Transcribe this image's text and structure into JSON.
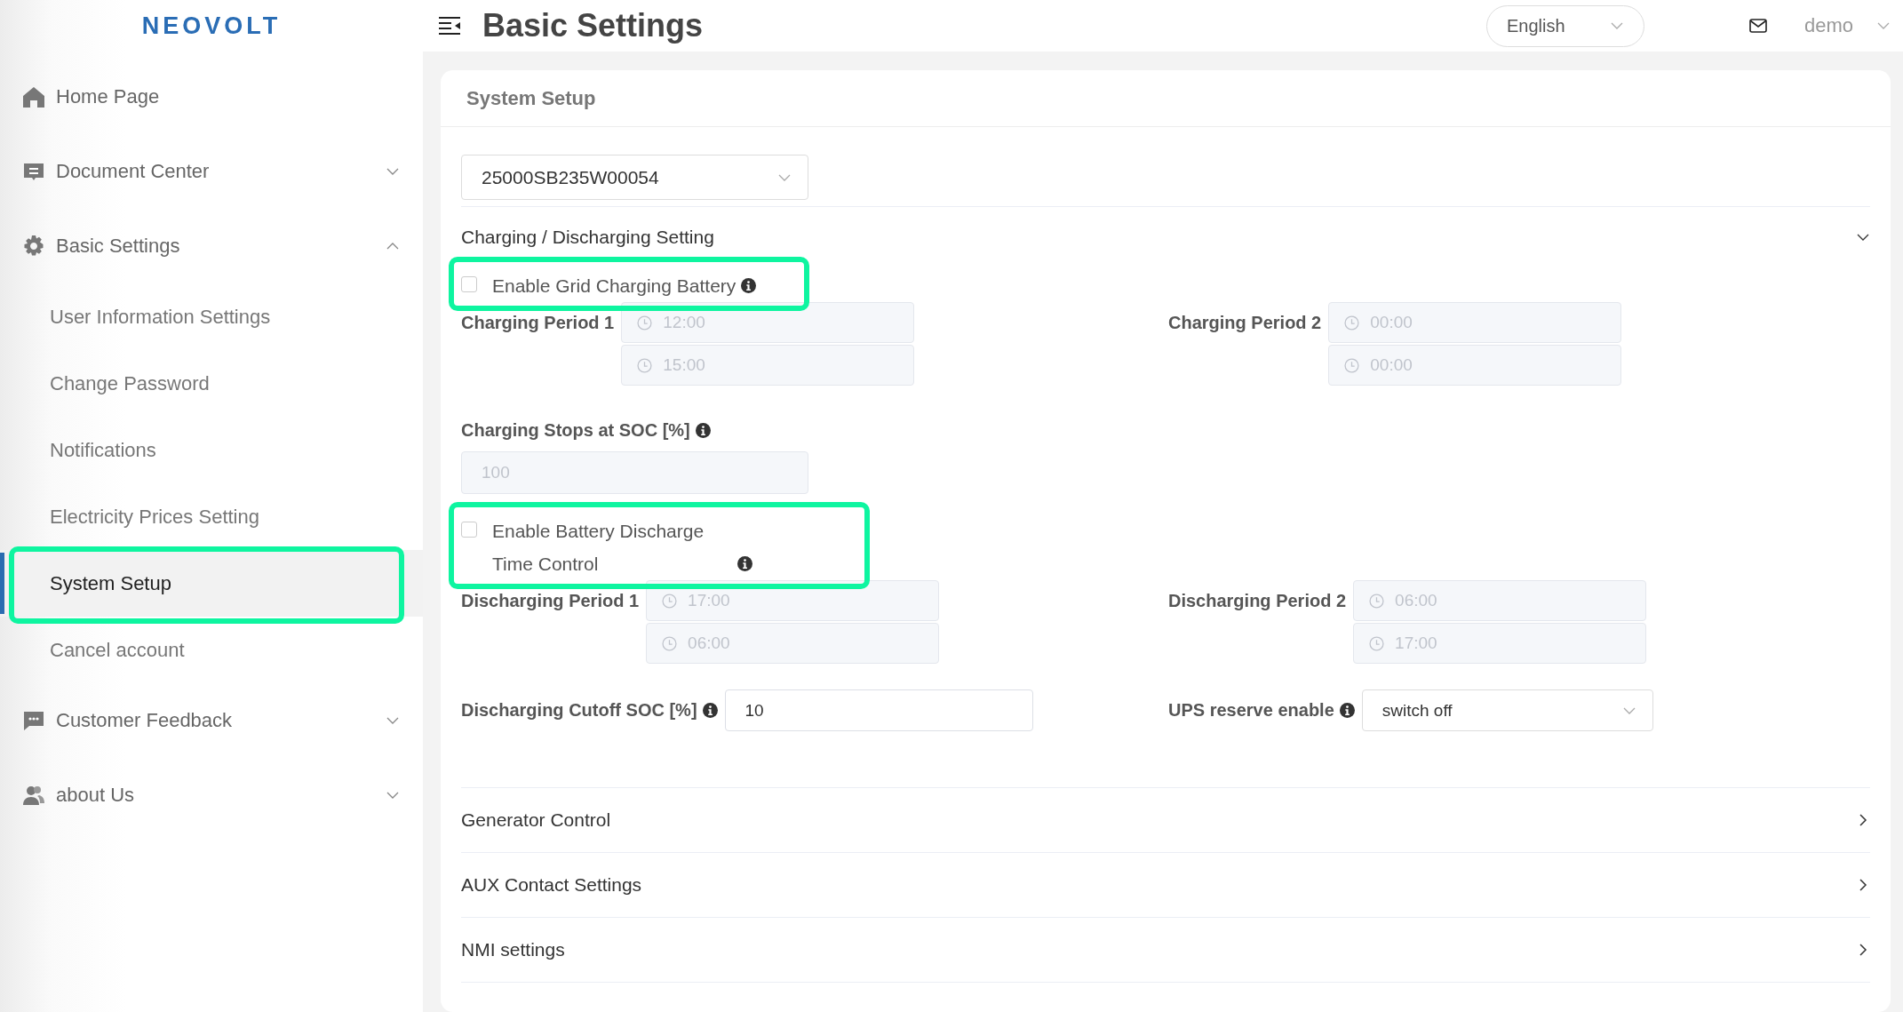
{
  "logo": "NEOVOLT",
  "header": {
    "title": "Basic Settings",
    "language": "English",
    "user": "demo"
  },
  "sidebar": {
    "items": [
      {
        "kind": "link",
        "label": "Home Page",
        "selected": false
      },
      {
        "kind": "group",
        "label": "Document Center",
        "expanded": false
      },
      {
        "kind": "group",
        "label": "Basic Settings",
        "expanded": true,
        "children": [
          {
            "label": "User Information Settings",
            "selected": false,
            "highlighted": false
          },
          {
            "label": "Change Password",
            "selected": false,
            "highlighted": false
          },
          {
            "label": "Notifications",
            "selected": false,
            "highlighted": false
          },
          {
            "label": "Electricity Prices Setting",
            "selected": false,
            "highlighted": false
          },
          {
            "label": "System Setup",
            "selected": true,
            "highlighted": true
          },
          {
            "label": "Cancel account",
            "selected": false,
            "highlighted": false
          }
        ]
      },
      {
        "kind": "group",
        "label": "Customer Feedback",
        "expanded": false
      },
      {
        "kind": "group",
        "label": "about Us",
        "expanded": false
      }
    ]
  },
  "card": {
    "title": "System Setup",
    "device": "25000SB235W00054"
  },
  "charging": {
    "title": "Charging / Discharging Setting",
    "expanded": true,
    "grid_charging": {
      "label": "Enable Grid Charging Battery",
      "checked": false,
      "highlighted": true
    },
    "charging_periods": [
      {
        "label": "Charging Period 1",
        "start": "12:00",
        "end": "15:00",
        "disabled": true
      },
      {
        "label": "Charging Period 2",
        "start": "00:00",
        "end": "00:00",
        "disabled": true
      }
    ],
    "stop_soc": {
      "label": "Charging Stops at SOC [%]",
      "value": "100",
      "disabled": true
    },
    "discharge_control": {
      "label": "Enable Battery Discharge Time Control",
      "checked": false,
      "highlighted": true
    },
    "discharging_periods": [
      {
        "label": "Discharging Period 1",
        "start": "17:00",
        "end": "06:00",
        "disabled": true
      },
      {
        "label": "Discharging Period 2",
        "start": "06:00",
        "end": "17:00",
        "disabled": true
      }
    ],
    "cutoff_soc": {
      "label": "Discharging Cutoff SOC [%]",
      "value": "10"
    },
    "ups_reserve": {
      "label": "UPS reserve enable",
      "value": "switch off"
    }
  },
  "other_sections": [
    {
      "title": "Generator Control",
      "expanded": false
    },
    {
      "title": "AUX Contact Settings",
      "expanded": false
    },
    {
      "title": "NMI settings",
      "expanded": false
    }
  ]
}
